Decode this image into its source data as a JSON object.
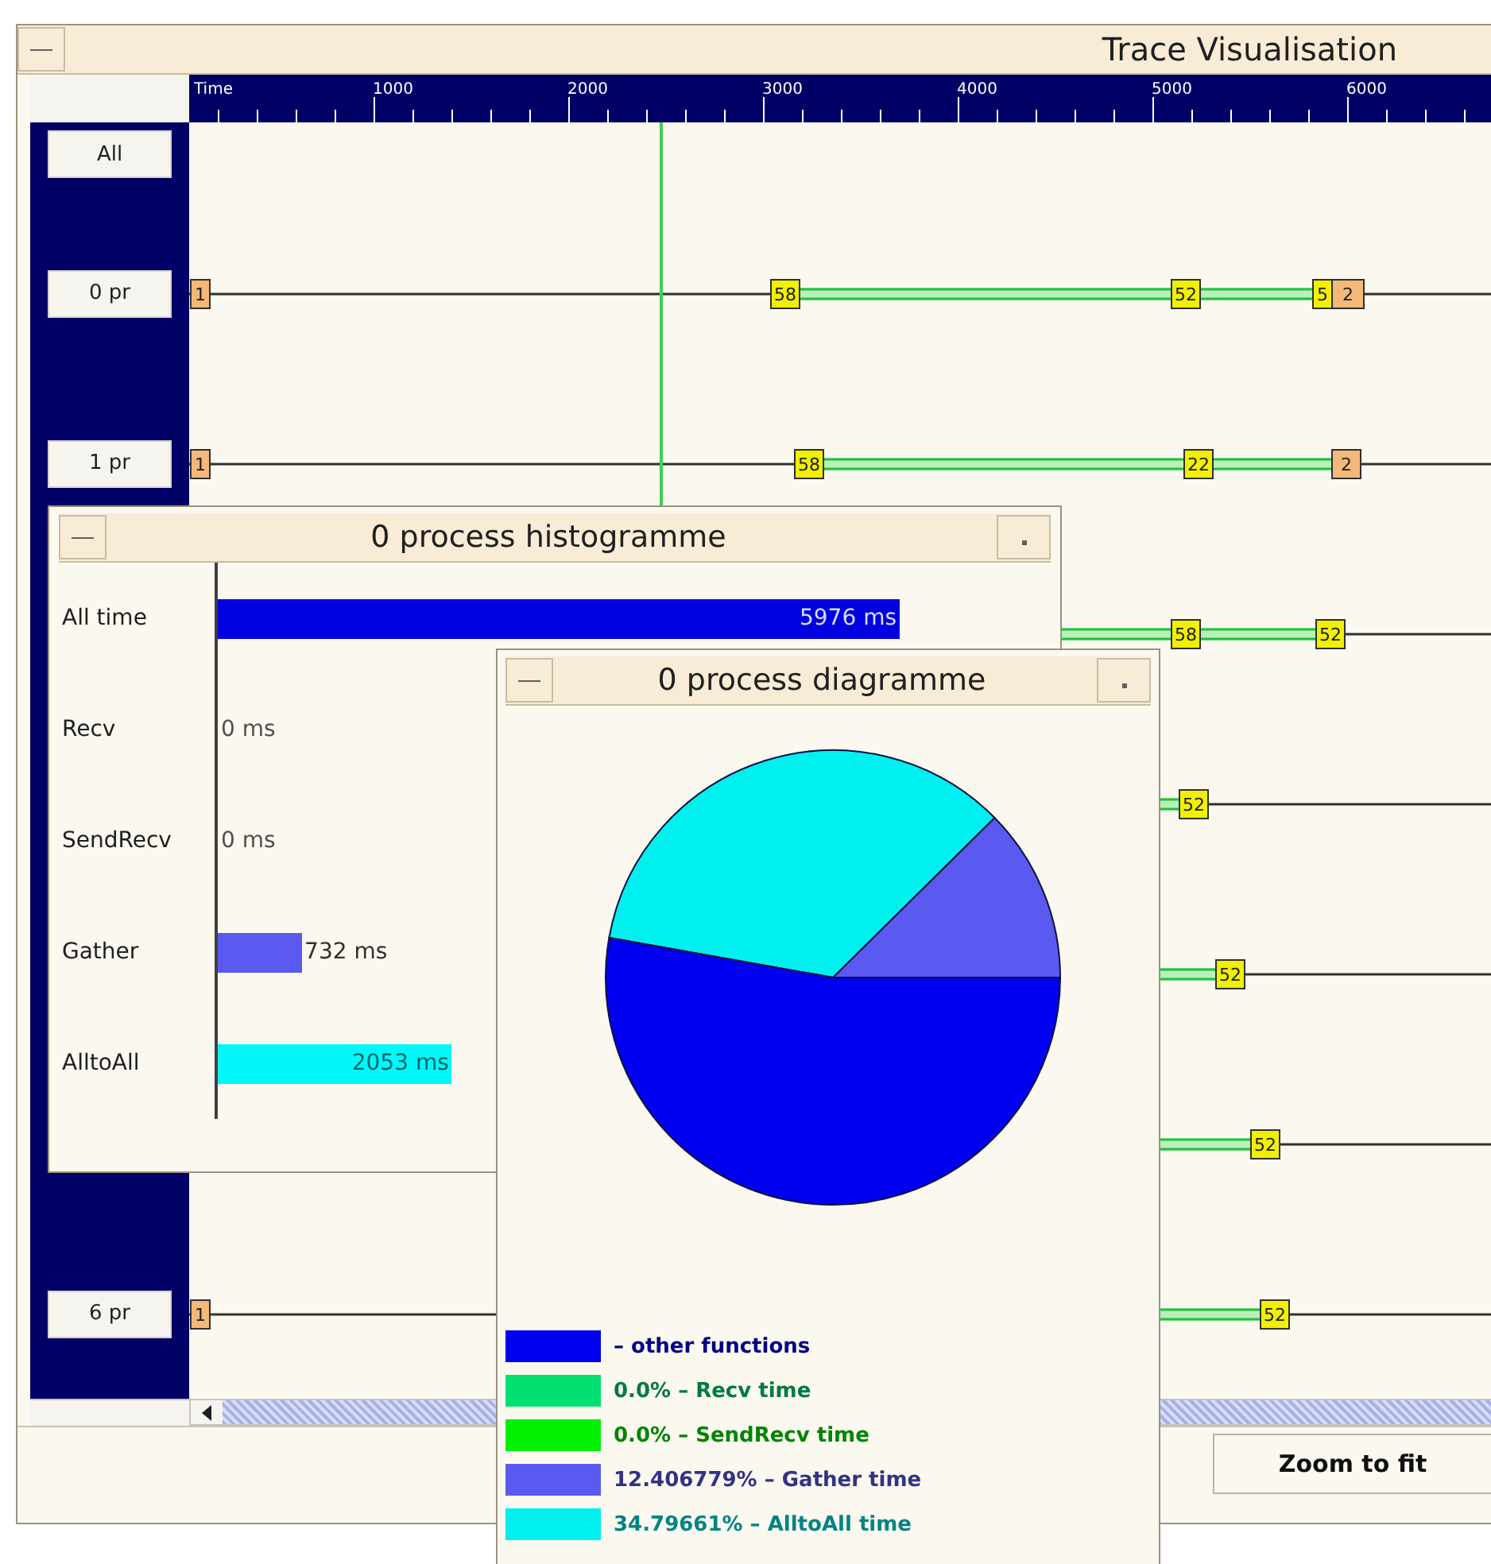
{
  "main_window": {
    "title": "Trace Visualisation",
    "ruler": {
      "labels": [
        "Time",
        "1000",
        "2000",
        "3000",
        "4000",
        "5000",
        "6000"
      ]
    },
    "all_button": "All",
    "processes": [
      {
        "label": "0 pr",
        "events": [
          {
            "text": "1",
            "kind": "start"
          },
          {
            "text": "58",
            "kind": "call"
          },
          {
            "text": "52",
            "kind": "call"
          },
          {
            "text": "5",
            "kind": "call"
          },
          {
            "text": "2",
            "kind": "end"
          }
        ]
      },
      {
        "label": "1 pr",
        "events": [
          {
            "text": "1",
            "kind": "start"
          },
          {
            "text": "58",
            "kind": "call"
          },
          {
            "text": "22",
            "kind": "call"
          },
          {
            "text": "2",
            "kind": "end"
          }
        ]
      },
      {
        "events": [
          {
            "text": "58",
            "kind": "call"
          },
          {
            "text": "52",
            "kind": "call"
          }
        ]
      },
      {
        "events": [
          {
            "text": "52",
            "kind": "call"
          }
        ]
      },
      {
        "events": [
          {
            "text": "52",
            "kind": "call"
          }
        ]
      },
      {
        "events": [
          {
            "text": "52",
            "kind": "call"
          }
        ]
      },
      {
        "label": "6 pr",
        "events": [
          {
            "text": "1",
            "kind": "start"
          },
          {
            "text": "52",
            "kind": "call"
          }
        ]
      }
    ],
    "buttons": [
      "Zoom to fit"
    ]
  },
  "histogram_window": {
    "title": "0 process histogramme",
    "chart_data": {
      "type": "bar",
      "orientation": "horizontal",
      "categories": [
        "All time",
        "Recv",
        "SendRecv",
        "Gather",
        "AlltoAll"
      ],
      "values": [
        5976,
        0,
        0,
        732,
        2053
      ],
      "value_labels": [
        "5976 ms",
        "0 ms",
        "0 ms",
        "732 ms",
        "2053 ms"
      ],
      "colors": [
        "#0000e0",
        null,
        null,
        "#5a5af0",
        "#00f8f8"
      ]
    }
  },
  "diagram_window": {
    "title": "0 process diagramme",
    "chart_data": {
      "type": "pie",
      "values": [
        52.796611,
        0,
        0,
        12.406779,
        34.79661
      ]
    },
    "legend": [
      {
        "label": "– other functions",
        "color": "#0000f0"
      },
      {
        "label": "0.0% – Recv time",
        "color": "#00e070"
      },
      {
        "label": "0.0% – SendRecv time",
        "color": "#00f000"
      },
      {
        "label": "12.406779% – Gather time",
        "color": "#5a5af0"
      },
      {
        "label": "34.79661% – AlltoAll time",
        "color": "#00f0f0"
      }
    ]
  }
}
